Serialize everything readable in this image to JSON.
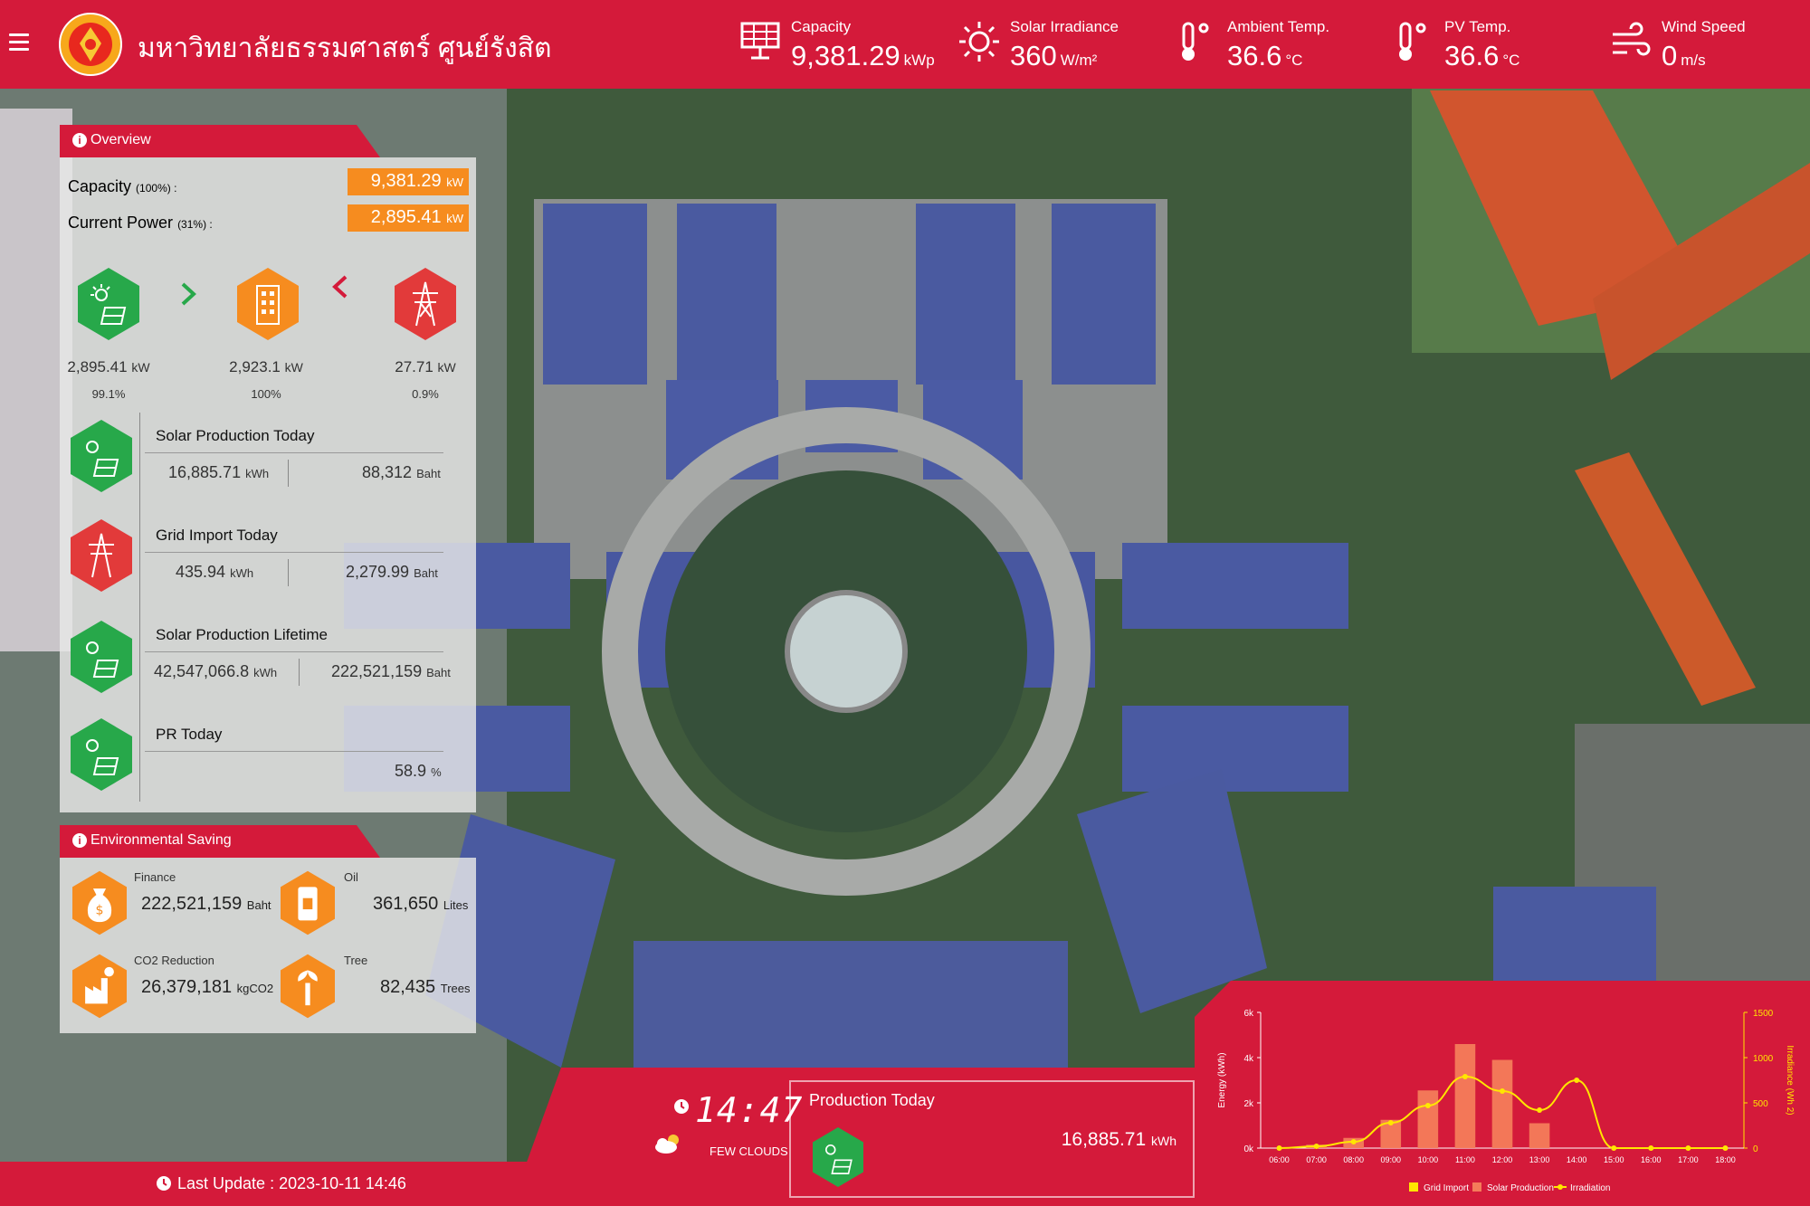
{
  "header": {
    "university_name": "มหาวิทยาลัยธรรมศาสตร์ ศูนย์รังสิต",
    "metrics": [
      {
        "label": "Capacity",
        "value": "9,381.29",
        "unit": "kWp",
        "icon": "solar-panel-icon"
      },
      {
        "label": "Solar Irradiance",
        "value": "360",
        "unit": "W/m²",
        "icon": "sun-icon"
      },
      {
        "label": "Ambient Temp.",
        "value": "36.6",
        "unit": "°C",
        "icon": "thermometer-icon"
      },
      {
        "label": "PV Temp.",
        "value": "36.6",
        "unit": "°C",
        "icon": "thermometer-icon"
      },
      {
        "label": "Wind Speed",
        "value": "0",
        "unit": "m/s",
        "icon": "wind-icon"
      }
    ]
  },
  "overview": {
    "tab_label": "Overview",
    "capacity_label": "Capacity",
    "capacity_pct": "(100%) :",
    "capacity_value": "9,381.29",
    "capacity_unit": "kW",
    "current_power_label": "Current Power",
    "current_power_pct": "(31%) :",
    "current_power_value": "2,895.41",
    "current_power_unit": "kW",
    "flow": {
      "solar": {
        "value": "2,895.41",
        "unit": "kW",
        "pct": "99.1%"
      },
      "building": {
        "value": "2,923.1",
        "unit": "kW",
        "pct": "100%"
      },
      "grid": {
        "value": "27.71",
        "unit": "kW",
        "pct": "0.9%"
      }
    },
    "stats": {
      "solar_today": {
        "title": "Solar Production Today",
        "energy": "16,885.71",
        "energy_unit": "kWh",
        "money": "88,312",
        "money_unit": "Baht"
      },
      "grid_today": {
        "title": "Grid Import Today",
        "energy": "435.94",
        "energy_unit": "kWh",
        "money": "2,279.99",
        "money_unit": "Baht"
      },
      "solar_lifetime": {
        "title": "Solar Production Lifetime",
        "energy": "42,547,066.8",
        "energy_unit": "kWh",
        "money": "222,521,159",
        "money_unit": "Baht"
      },
      "pr_today": {
        "title": "PR Today",
        "value": "58.9",
        "unit": "%"
      }
    }
  },
  "environment": {
    "tab_label": "Environmental Saving",
    "finance": {
      "label": "Finance",
      "value": "222,521,159",
      "unit": "Baht"
    },
    "oil": {
      "label": "Oil",
      "value": "361,650",
      "unit": "Lites"
    },
    "co2": {
      "label": "CO2 Reduction",
      "value": "26,379,181",
      "unit": "kgCO2"
    },
    "tree": {
      "label": "Tree",
      "value": "82,435",
      "unit": "Trees"
    }
  },
  "footer": {
    "last_update": "Last Update : 2023-10-11 14:46",
    "time": "14:47",
    "weather": "FEW CLOUDS",
    "production_title": "Production Today",
    "production_value": "16,885.71",
    "production_unit": "kWh"
  },
  "colors": {
    "brand_red": "#d41a3a",
    "orange": "#f68c1f",
    "green": "#27a84a",
    "chart_bar": "#f47c5a",
    "irradiation": "#ffe600"
  },
  "chart_data": {
    "type": "bar",
    "categories": [
      "06:00",
      "07:00",
      "08:00",
      "09:00",
      "10:00",
      "11:00",
      "12:00",
      "13:00",
      "14:00",
      "15:00",
      "16:00",
      "17:00",
      "18:00"
    ],
    "series": [
      {
        "name": "Grid Import",
        "values": [
          0,
          0,
          0,
          0,
          0,
          0,
          0,
          0,
          0,
          0,
          0,
          0,
          0
        ]
      },
      {
        "name": "Solar Production",
        "values": [
          0,
          150,
          450,
          1250,
          2550,
          4600,
          3900,
          1100,
          0,
          0,
          0,
          0,
          0
        ]
      },
      {
        "name": "Irradiation",
        "values": [
          0,
          20,
          70,
          280,
          470,
          790,
          630,
          420,
          750,
          0,
          0,
          0,
          0
        ]
      }
    ],
    "ylabel": "Energy (kWh)",
    "ylabel_right": "Irradiance (Wh 2)",
    "ylim": [
      0,
      6000
    ],
    "ylim_right": [
      0,
      1500
    ],
    "yticks": [
      "0k",
      "2k",
      "4k",
      "6k"
    ],
    "yticks_right": [
      "0",
      "500",
      "1000",
      "1500"
    ],
    "legend": [
      "Grid Import",
      "Solar Production",
      "Irradiation"
    ]
  }
}
